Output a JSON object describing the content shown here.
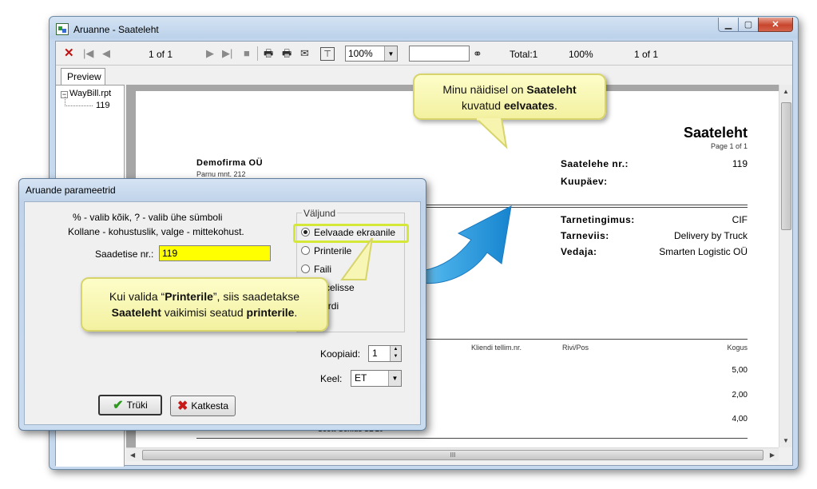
{
  "window": {
    "title": "Aruanne - Saateleht"
  },
  "toolbar": {
    "page_indicator": "1 of 1",
    "zoom_value": "100%",
    "search_placeholder": "",
    "total_label": "Total:1",
    "zoom_percent": "100%",
    "page_of": "1 of 1"
  },
  "tabs": {
    "preview": "Preview"
  },
  "tree": {
    "root": "WayBill.rpt",
    "child": "119"
  },
  "report": {
    "title": "Saateleht",
    "page_info": "Page 1 of 1",
    "company": "Demofirma OÜ",
    "address": "Parnu mnt. 212",
    "waybill_no_label": "Saatelehe nr.:",
    "waybill_no_value": "119",
    "date_label": "Kuupäev:",
    "terms_label": "Tarnetingimus:",
    "terms_value": "CIF",
    "delivery_label": "Tarneviis:",
    "delivery_value": "Delivery by Truck",
    "carrier_label": "Vedaja:",
    "carrier_value": "Smarten Logistic OÜ",
    "columns": [
      "Kliendi tellim.nr.",
      "Rivi/Pos",
      "Kogus"
    ],
    "quantities": [
      "5,00",
      "2,00",
      "4,00"
    ],
    "item_partial": "Scott Genius SL 20"
  },
  "dialog": {
    "title": "Aruande parameetrid",
    "hint_line1": "% - valib kõik, ? - valib ühe sümboli",
    "hint_line2": "Kollane - kohustuslik, valge - mittekohust.",
    "waybill_field_label": "Saadetise nr.:",
    "waybill_field_value": "119",
    "output_group_label": "Väljund",
    "output_options": [
      "Eelvaade ekraanile",
      "Printerile",
      "Faili",
      "Excelisse",
      "Wordi"
    ],
    "output_selected": "Eelvaade ekraanile",
    "copies_label": "Koopiaid:",
    "copies_value": "1",
    "language_label": "Keel:",
    "language_value": "ET",
    "print_button": "Trüki",
    "cancel_button": "Katkesta"
  },
  "callouts": {
    "top": {
      "line1_a": "Minu näidisel on ",
      "line1_b": "Saateleht",
      "line2_a": "kuvatud ",
      "line2_b": "eelvaates",
      "line2_c": "."
    },
    "bottom": {
      "l1_a": "Kui valida “",
      "l1_b": "Printerile",
      "l1_c": "”, siis saadetakse",
      "l2_a": "Saateleht",
      "l2_b": " vaikimisi seatud ",
      "l2_c": "printerile",
      "l2_d": "."
    }
  },
  "colors": {
    "highlight_field": "#ffff00",
    "callout_fill": "#fbfabb",
    "arrow_blue": "#2a9be0",
    "selection_border": "#d5e83a"
  },
  "icons": [
    "app-icon",
    "close-x-icon",
    "first-page-icon",
    "prev-page-icon",
    "next-page-icon",
    "last-page-icon",
    "stop-icon",
    "print-icon",
    "print-setup-icon",
    "export-icon",
    "tree-toggle-icon",
    "binoculars-icon",
    "check-icon",
    "cross-icon"
  ]
}
